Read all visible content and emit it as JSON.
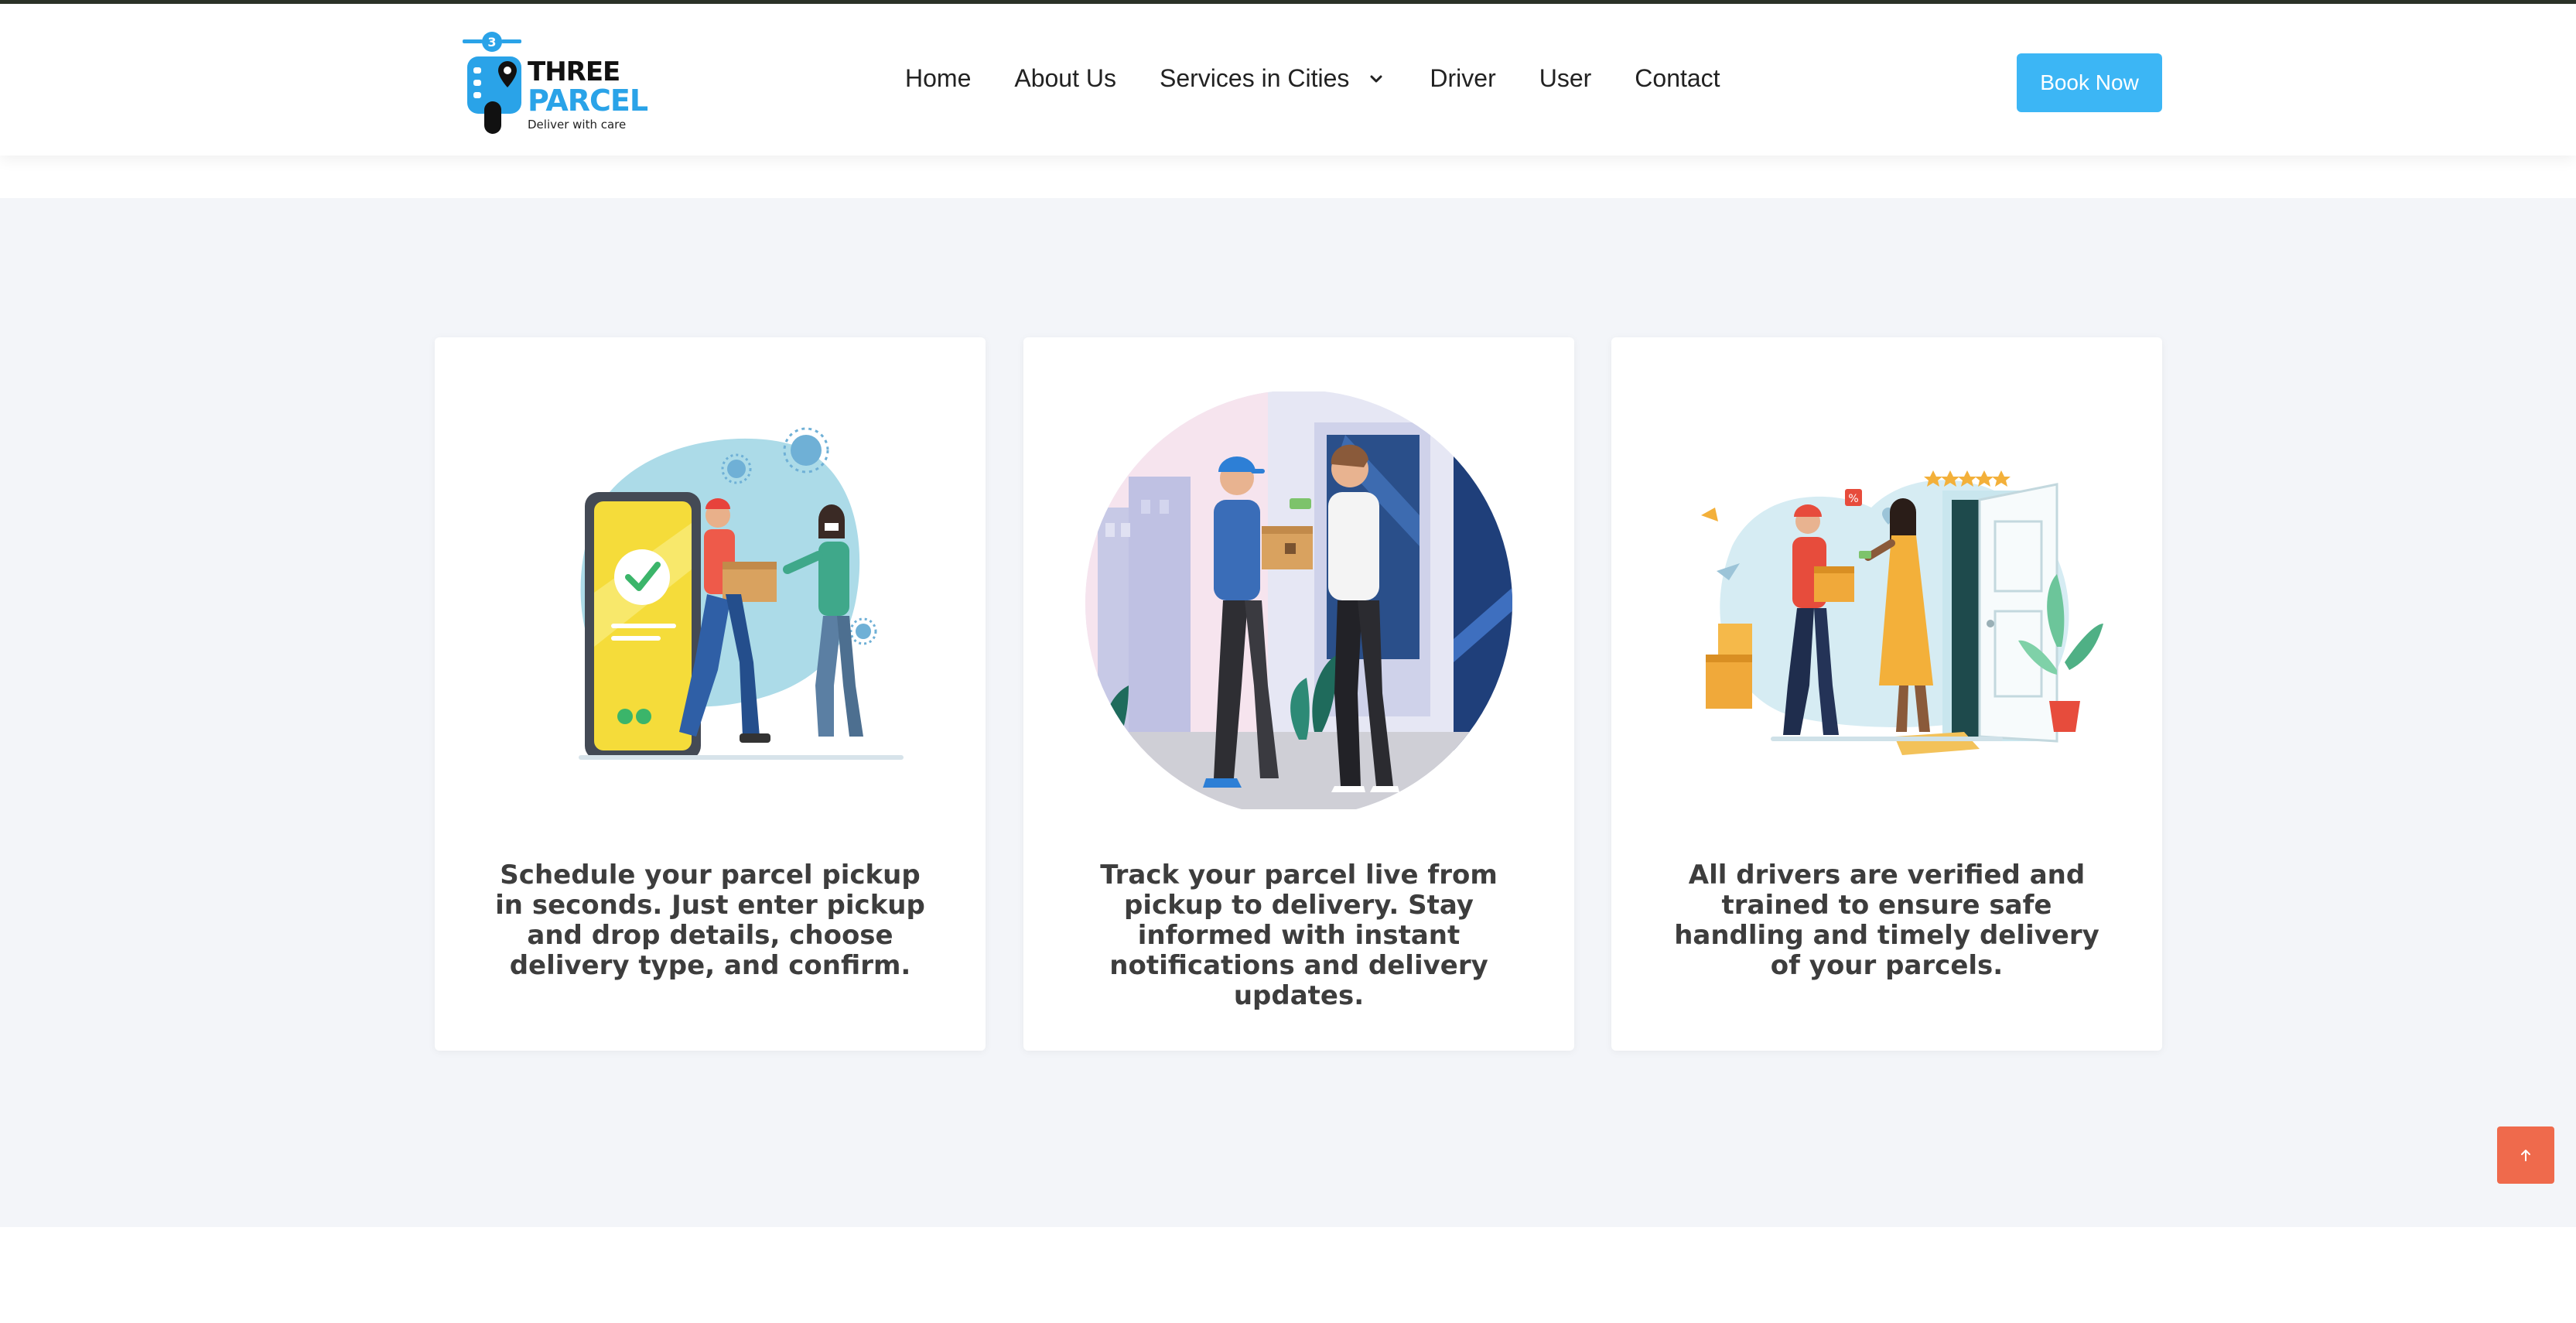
{
  "brand": {
    "name_line1": "THREE",
    "name_line2": "PARCEL",
    "tagline": "Deliver with care",
    "primary_color": "#2aa3e8"
  },
  "nav": {
    "items": [
      {
        "label": "Home"
      },
      {
        "label": "About Us"
      },
      {
        "label": "Services in Cities",
        "has_dropdown": true
      },
      {
        "label": "Driver"
      },
      {
        "label": "User"
      },
      {
        "label": "Contact"
      }
    ],
    "cta_label": "Book Now",
    "cta_color": "#3cb6f5"
  },
  "features": [
    {
      "text": "Schedule your parcel pickup in seconds. Just enter pickup and drop details, choose delivery type, and confirm.",
      "illustration": "phone-parcel-handoff"
    },
    {
      "text": "Track your parcel live from pickup to delivery. Stay informed with instant notifications and delivery updates.",
      "illustration": "doorstep-delivery"
    },
    {
      "text": "All drivers are verified and trained to ensure safe handling and timely delivery of your parcels.",
      "illustration": "verified-driver-delivery"
    }
  ],
  "scroll_top": {
    "icon": "arrow-up-icon",
    "color": "#ef6a4c"
  }
}
